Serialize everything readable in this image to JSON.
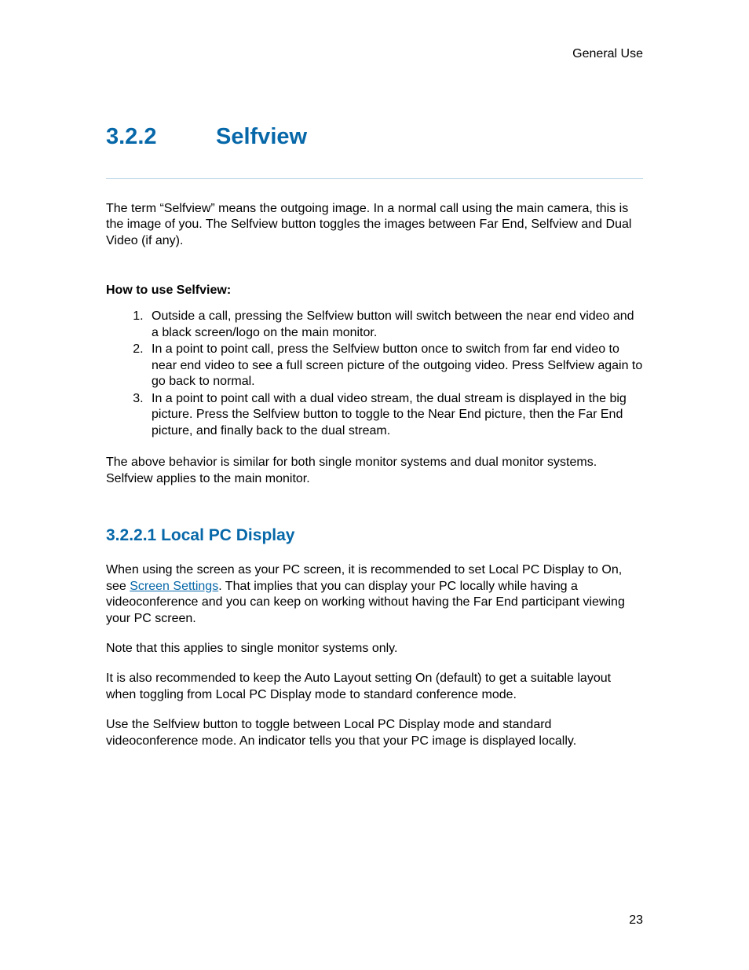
{
  "header": {
    "right": "General Use"
  },
  "chapter": {
    "number": "3.2.2",
    "title": "Selfview"
  },
  "intro": "The term “Selfview” means the outgoing image. In a normal call using the main camera, this is the image of you. The Selfview button toggles the images between Far End, Selfview and Dual Video (if any).",
  "howto": {
    "label": "How to use Selfview:",
    "items": [
      "Outside a call, pressing the Selfview button will switch between the near end video and a black screen/logo on the main monitor.",
      "In a point to point call, press the Selfview button once to switch from far end video to near end video to see a full screen picture of the outgoing video. Press Selfview again to go back to normal.",
      "In a point to point call with a dual video stream, the dual stream is displayed in the big picture. Press the Selfview button to toggle to the Near End picture, then the Far End picture, and finally back to the dual stream."
    ]
  },
  "note_after_list": "The above behavior is similar for both single monitor systems and dual monitor systems. Selfview applies to the main monitor.",
  "sub": {
    "number": "3.2.2.1",
    "title": "Local PC Display",
    "para1_pre": "When using the screen as your PC screen, it is recommended to set Local PC Display to On, see ",
    "link_text": "Screen Settings",
    "para1_post": ". That implies that you can display your PC locally while having a videoconference and you can keep on working without having the Far End participant viewing your PC screen.",
    "para2": "Note that this applies to single monitor systems only.",
    "para3": "It is also recommended to keep the Auto Layout setting On (default) to get a suitable layout when toggling from Local PC Display mode to standard conference mode.",
    "para4": "Use the Selfview button to toggle between Local PC Display mode and standard videoconference mode. An indicator tells you that your PC image is displayed locally."
  },
  "page_number": "23"
}
